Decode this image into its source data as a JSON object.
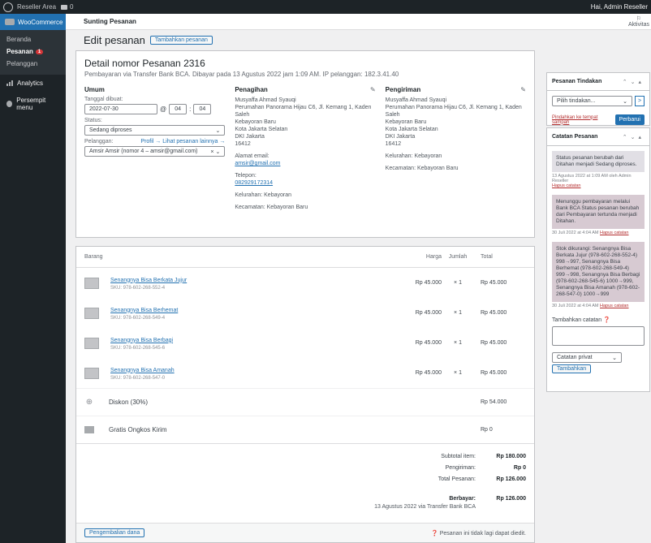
{
  "adminbar": {
    "site": "Reseller Area",
    "comments": "0",
    "howdy": "Hai, Admin Reseller"
  },
  "sidebar": {
    "woocommerce": "WooCommerce",
    "sub": [
      "Beranda",
      "Pesanan",
      "Pelanggan"
    ],
    "orders_badge": "1",
    "analytics": "Analytics",
    "collapse": "Persempit menu"
  },
  "topbar": {
    "breadcrumb": "Sunting Pesanan",
    "activity": "Aktivitas"
  },
  "title": {
    "heading": "Edit pesanan",
    "add_button": "Tambahkan pesanan"
  },
  "order": {
    "title": "Detail nomor Pesanan 2316",
    "meta": "Pembayaran via Transfer Bank BCA. Dibayar pada 13 Agustus 2022 jam 1:09 AM. IP pelanggan: 182.3.41.40",
    "general": {
      "heading": "Umum",
      "created_label": "Tanggal dibuat:",
      "date": "2022-07-30",
      "hour": "04",
      "minute": "04",
      "status_label": "Status:",
      "status": "Sedang diproses",
      "customer_label": "Pelanggan:",
      "profile_link": "Profil →",
      "other_orders_link": "Lihat pesanan lainnya →",
      "customer": "Amsir Amsir (nomor 4 – amsir@gmail.com)"
    },
    "billing": {
      "heading": "Penagihan",
      "address": [
        "Musyaffa Ahmad Syauqi",
        "Perumahan Panorama Hijau C6, Jl. Kemang 1, Kaden Saleh",
        "Kebayoran Baru",
        "Kota Jakarta Selatan",
        "DKI Jakarta",
        "16412"
      ],
      "email_label": "Alamat email:",
      "email": "amsir@gmail.com",
      "phone_label": "Telepon:",
      "phone": "082929172314",
      "kel_label": "Kelurahan:",
      "kel": "Kebayoran",
      "kec_label": "Kecamatan:",
      "kec": "Kebayoran Baru"
    },
    "shipping": {
      "heading": "Pengiriman",
      "address": [
        "Musyaffa Ahmad Syauqi",
        "Perumahan Panorama Hijau C6, Jl. Kemang 1, Kaden Saleh",
        "Kebayoran Baru",
        "Kota Jakarta Selatan",
        "DKI Jakarta",
        "16412"
      ],
      "kel_label": "Kelurahan:",
      "kel": "Kebayoran",
      "kec_label": "Kecamatan:",
      "kec": "Kebayoran Baru"
    }
  },
  "items": {
    "headers": {
      "item": "Barang",
      "cost": "Harga",
      "qty": "Jumlah",
      "total": "Total"
    },
    "rows": [
      {
        "name": "Senangnya Bisa Berkata Jujur",
        "sku": "SKU: 978-602-268-552-4",
        "cost": "Rp 45.000",
        "qty": "× 1",
        "total": "Rp 45.000"
      },
      {
        "name": "Senangnya Bisa Berhemat",
        "sku": "SKU: 978-602-268-549-4",
        "cost": "Rp 45.000",
        "qty": "× 1",
        "total": "Rp 45.000"
      },
      {
        "name": "Senangnya Bisa Berbagi",
        "sku": "SKU: 978-602-268-545-6",
        "cost": "Rp 45.000",
        "qty": "× 1",
        "total": "Rp 45.000"
      },
      {
        "name": "Senangnya Bisa Amanah",
        "sku": "SKU: 978-602-268-547-0",
        "cost": "Rp 45.000",
        "qty": "× 1",
        "total": "Rp 45.000"
      }
    ],
    "fee": {
      "label": "Diskon (30%)",
      "total": "Rp 54.000"
    },
    "shipping": {
      "label": "Gratis Ongkos Kirim",
      "total": "Rp 0"
    },
    "totals": {
      "subtotal_label": "Subtotal item:",
      "subtotal": "Rp 180.000",
      "shipping_label": "Pengiriman:",
      "shipping": "Rp 0",
      "order_total_label": "Total Pesanan:",
      "order_total": "Rp 126.000",
      "paid_label": "Berbayar:",
      "paid": "Rp 126.000",
      "paid_note": "13 Agustus 2022 via Transfer Bank BCA"
    },
    "refund_button": "Pengembalian dana",
    "not_editable": "Pesanan ini tidak lagi dapat diedit."
  },
  "actions": {
    "heading": "Pesanan Tindakan",
    "select": "Pilih tindakan...",
    "go": ">",
    "trash": "Pindahkan ke tempat sampah",
    "update": "Perbarui"
  },
  "notes": {
    "heading": "Catatan Pesanan",
    "list": [
      {
        "text": "Status pesanan berubah dari Ditahan menjadi Sedang diproses.",
        "meta": "13 Agustus 2022 at 1:09 AM oleh Admin Reseller",
        "delete": "Hapus catatan"
      },
      {
        "text": "Menunggu pembayaran melalui Bank BCA Status pesanan berubah dari Pembayaran tertunda menjadi Ditahan.",
        "meta": "30 Juli 2022 at 4:04 AM",
        "delete": "Hapus catatan"
      },
      {
        "text": "Stok dikurangi: Senangnya Bisa Berkata Jujur (978-602-268-552-4) 998→997, Senangnya Bisa Berhemat (978-602-268-549-4) 999→998, Senangnya Bisa Berbagi (978-602-268-545-6) 1000→999, Senangnya Bisa Amanah (978-602-268-547-0) 1000→999",
        "meta": "30 Juli 2022 at 4:04 AM",
        "delete": "Hapus catatan"
      }
    ],
    "add_label": "Tambahkan catatan",
    "type": "Catatan privat",
    "add_button": "Tambahkan"
  }
}
